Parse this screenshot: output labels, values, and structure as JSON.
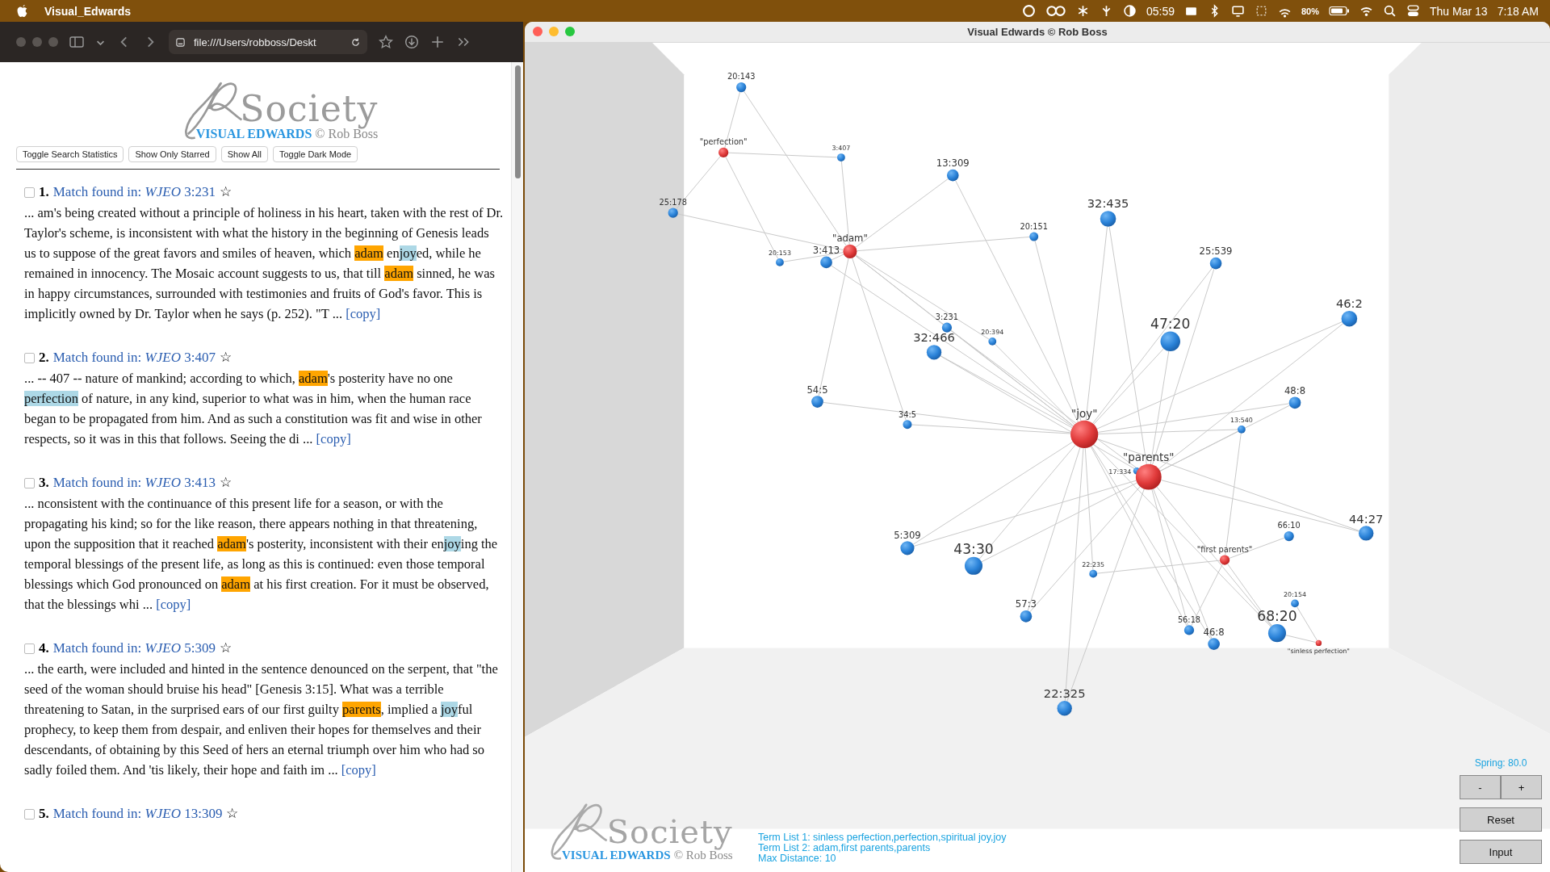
{
  "menu_bar": {
    "app_name": "Visual_Edwards",
    "clock": "05:59",
    "battery": "80%",
    "date": "Thu Mar 13",
    "time": "7:18 AM"
  },
  "browser": {
    "address": "file:///Users/robboss/Deskt",
    "logo": {
      "wordmark": "Society",
      "product": "VISUAL EDWARDS",
      "credit": "© Rob Boss"
    },
    "buttons": [
      "Toggle Search Statistics",
      "Show Only Starred",
      "Show All",
      "Toggle Dark Mode"
    ],
    "results": [
      {
        "number": "1.",
        "title": "Match found in: *WJEO* 3:231",
        "star": "☆",
        "checked": false,
        "copy": "[copy]",
        "segments": [
          {
            "text": "... am's being created without a principle of holiness in his heart, taken with the rest of Dr. Taylor's scheme, is inconsistent with what the history in the beginning of Genesis leads us to suppose of the great favors and smiles of heaven, which "
          },
          {
            "text": "adam",
            "color": "#ffa500"
          },
          {
            "text": " en"
          },
          {
            "text": "joy",
            "color": "#add8e6"
          },
          {
            "text": "ed, while he remained in innocency. The Mosaic account suggests to us, that till "
          },
          {
            "text": "adam",
            "color": "#ffa500"
          },
          {
            "text": " sinned, he was in happy circumstances, surrounded with testimonies and fruits of God's favor. This is implicitly owned by Dr. Taylor when he says (p. 252). \"T ... "
          }
        ]
      },
      {
        "number": "2.",
        "title": "Match found in: *WJEO* 3:407",
        "star": "☆",
        "checked": false,
        "copy": "[copy]",
        "segments": [
          {
            "text": "... -- 407 -- nature of mankind; according to which, "
          },
          {
            "text": "adam",
            "color": "#ffa500"
          },
          {
            "text": "'s posterity have no one "
          },
          {
            "text": "perfection",
            "color": "#add8e6"
          },
          {
            "text": " of nature, in any kind, superior to what was in him, when the human race began to be propagated from him. And as such a constitution was fit and wise in other respects, so it was in this that follows. Seeing the di ... "
          }
        ]
      },
      {
        "number": "3.",
        "title": "Match found in: *WJEO* 3:413",
        "star": "☆",
        "checked": false,
        "copy": "[copy]",
        "segments": [
          {
            "text": "... nconsistent with the continuance of this present life for a season, or with the propagating his kind; so for the like reason, there appears nothing in that threatening, upon the supposition that it reached "
          },
          {
            "text": "adam",
            "color": "#ffa500"
          },
          {
            "text": "'s posterity, inconsistent with their en"
          },
          {
            "text": "joy",
            "color": "#add8e6"
          },
          {
            "text": "ing the temporal blessings of the present life, as long as this is continued: even those temporal blessings which God pronounced on "
          },
          {
            "text": "adam",
            "color": "#ffa500"
          },
          {
            "text": " at his first creation. For it must be observed, that the blessings whi ... "
          }
        ]
      },
      {
        "number": "4.",
        "title": "Match found in: *WJEO* 5:309",
        "star": "☆",
        "checked": false,
        "copy": "[copy]",
        "segments": [
          {
            "text": "... the earth, were included and hinted in the sentence denounced on the serpent, that \"the seed of the woman should bruise his head\" [Genesis 3:15]. What was a terrible threatening to Satan, in the surprised ears of our first guilty "
          },
          {
            "text": "parents",
            "color": "#ffa500"
          },
          {
            "text": ", implied a "
          },
          {
            "text": "joy",
            "color": "#add8e6"
          },
          {
            "text": "ful prophecy, to keep them from despair, and enliven their hopes for themselves and their descendants, of obtaining by this Seed of hers an eternal triumph over him who had so sadly foiled them. And 'tis likely, their hope and faith im ... "
          }
        ]
      },
      {
        "number": "5.",
        "title": "Match found in: *WJEO* 13:309",
        "star": "☆",
        "checked": false
      }
    ]
  },
  "graph_window": {
    "title": "Visual Edwards © Rob Boss",
    "nodes": [
      {
        "label": "20:143",
        "kind": "match"
      },
      {
        "label": "\"perfection\"",
        "kind": "term"
      },
      {
        "label": "3:407",
        "kind": "match"
      },
      {
        "label": "25:178",
        "kind": "match"
      },
      {
        "label": "13:309",
        "kind": "match"
      },
      {
        "label": "\"adam\"",
        "kind": "term"
      },
      {
        "label": "20:153",
        "kind": "match"
      },
      {
        "label": "3:413",
        "kind": "match"
      },
      {
        "label": "20:151",
        "kind": "match"
      },
      {
        "label": "32:435",
        "kind": "match"
      },
      {
        "label": "25:539",
        "kind": "match"
      },
      {
        "label": "46:2",
        "kind": "match"
      },
      {
        "label": "47:20",
        "kind": "match"
      },
      {
        "label": "3:231",
        "kind": "match"
      },
      {
        "label": "20:394",
        "kind": "match"
      },
      {
        "label": "32:466",
        "kind": "match"
      },
      {
        "label": "54:5",
        "kind": "match"
      },
      {
        "label": "34:5",
        "kind": "match"
      },
      {
        "label": "\"joy\"",
        "kind": "term"
      },
      {
        "label": "48:8",
        "kind": "match"
      },
      {
        "label": "13:540",
        "kind": "match"
      },
      {
        "label": "17:334",
        "kind": "match"
      },
      {
        "label": "\"parents\"",
        "kind": "term"
      },
      {
        "label": "5:309",
        "kind": "match"
      },
      {
        "label": "43:30",
        "kind": "match"
      },
      {
        "label": "22:235",
        "kind": "match"
      },
      {
        "label": "\"first parents\"",
        "kind": "term"
      },
      {
        "label": "66:10",
        "kind": "match"
      },
      {
        "label": "44:27",
        "kind": "match"
      },
      {
        "label": "57:3",
        "kind": "match"
      },
      {
        "label": "56:18",
        "kind": "match"
      },
      {
        "label": "46:8",
        "kind": "match"
      },
      {
        "label": "68:20",
        "kind": "match"
      },
      {
        "label": "20:154",
        "kind": "match"
      },
      {
        "label": "\"sinless perfection\"",
        "kind": "term"
      },
      {
        "label": "22:325",
        "kind": "match"
      }
    ],
    "logo": {
      "wordmark": "Society",
      "product": "VISUAL EDWARDS",
      "credit": "© Rob Boss"
    },
    "info": [
      "Term List 1: sinless perfection,perfection,spiritual joy,joy",
      "Term List 2: adam,first parents,parents",
      "Max Distance: 10"
    ],
    "spring": "Spring: 80.0",
    "buttons": [
      "-",
      "+",
      "Reset",
      "Input"
    ]
  }
}
